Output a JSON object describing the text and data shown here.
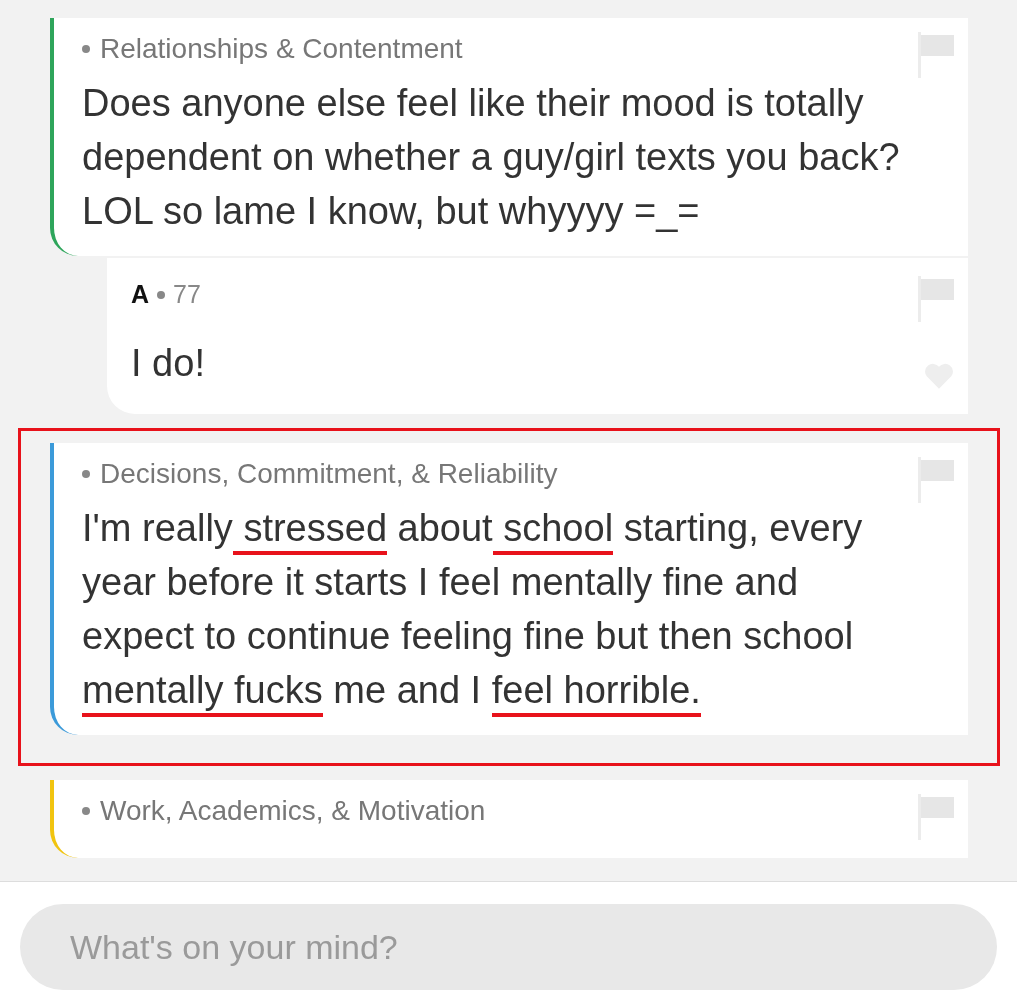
{
  "feed": [
    {
      "kind": "post",
      "color": "#2ea55b",
      "highlighted": false,
      "category": "Relationships & Contentment",
      "segments": [
        {
          "text": "Does anyone else feel like their mood is totally dependent on whether a guy/girl texts you back? LOL so lame I know, but whyyyy =_=",
          "underlined": false
        }
      ]
    },
    {
      "kind": "reply",
      "author": "A",
      "score": "77",
      "segments": [
        {
          "text": "I do!",
          "underlined": false
        }
      ]
    },
    {
      "kind": "post",
      "color": "#3b9ad9",
      "highlighted": true,
      "category": "Decisions, Commitment, & Reliability",
      "segments": [
        {
          "text": "I'm really",
          "underlined": false
        },
        {
          "text": " stressed",
          "underlined": true
        },
        {
          "text": " about",
          "underlined": false
        },
        {
          "text": " school",
          "underlined": true
        },
        {
          "text": " starting, every year before it starts I feel mentally fine and expect to continue feeling fine but then school ",
          "underlined": false
        },
        {
          "text": "mentally fucks",
          "underlined": true
        },
        {
          "text": " me and I ",
          "underlined": false
        },
        {
          "text": "feel horrible.",
          "underlined": true
        }
      ]
    },
    {
      "kind": "post",
      "color": "#f1c40f",
      "highlighted": false,
      "category": "Work, Academics, & Motivation"
    }
  ],
  "composer": {
    "placeholder": "What's on your mind?"
  }
}
